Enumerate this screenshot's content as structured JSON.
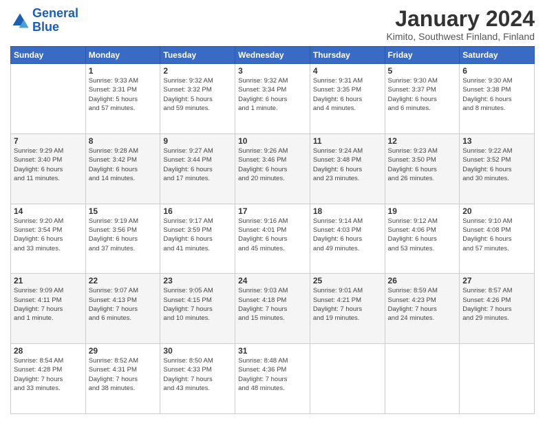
{
  "header": {
    "logo_line1": "General",
    "logo_line2": "Blue",
    "month": "January 2024",
    "location": "Kimito, Southwest Finland, Finland"
  },
  "weekdays": [
    "Sunday",
    "Monday",
    "Tuesday",
    "Wednesday",
    "Thursday",
    "Friday",
    "Saturday"
  ],
  "weeks": [
    [
      {
        "day": "",
        "info": ""
      },
      {
        "day": "1",
        "info": "Sunrise: 9:33 AM\nSunset: 3:31 PM\nDaylight: 5 hours\nand 57 minutes."
      },
      {
        "day": "2",
        "info": "Sunrise: 9:32 AM\nSunset: 3:32 PM\nDaylight: 5 hours\nand 59 minutes."
      },
      {
        "day": "3",
        "info": "Sunrise: 9:32 AM\nSunset: 3:34 PM\nDaylight: 6 hours\nand 1 minute."
      },
      {
        "day": "4",
        "info": "Sunrise: 9:31 AM\nSunset: 3:35 PM\nDaylight: 6 hours\nand 4 minutes."
      },
      {
        "day": "5",
        "info": "Sunrise: 9:30 AM\nSunset: 3:37 PM\nDaylight: 6 hours\nand 6 minutes."
      },
      {
        "day": "6",
        "info": "Sunrise: 9:30 AM\nSunset: 3:38 PM\nDaylight: 6 hours\nand 8 minutes."
      }
    ],
    [
      {
        "day": "7",
        "info": "Sunrise: 9:29 AM\nSunset: 3:40 PM\nDaylight: 6 hours\nand 11 minutes."
      },
      {
        "day": "8",
        "info": "Sunrise: 9:28 AM\nSunset: 3:42 PM\nDaylight: 6 hours\nand 14 minutes."
      },
      {
        "day": "9",
        "info": "Sunrise: 9:27 AM\nSunset: 3:44 PM\nDaylight: 6 hours\nand 17 minutes."
      },
      {
        "day": "10",
        "info": "Sunrise: 9:26 AM\nSunset: 3:46 PM\nDaylight: 6 hours\nand 20 minutes."
      },
      {
        "day": "11",
        "info": "Sunrise: 9:24 AM\nSunset: 3:48 PM\nDaylight: 6 hours\nand 23 minutes."
      },
      {
        "day": "12",
        "info": "Sunrise: 9:23 AM\nSunset: 3:50 PM\nDaylight: 6 hours\nand 26 minutes."
      },
      {
        "day": "13",
        "info": "Sunrise: 9:22 AM\nSunset: 3:52 PM\nDaylight: 6 hours\nand 30 minutes."
      }
    ],
    [
      {
        "day": "14",
        "info": "Sunrise: 9:20 AM\nSunset: 3:54 PM\nDaylight: 6 hours\nand 33 minutes."
      },
      {
        "day": "15",
        "info": "Sunrise: 9:19 AM\nSunset: 3:56 PM\nDaylight: 6 hours\nand 37 minutes."
      },
      {
        "day": "16",
        "info": "Sunrise: 9:17 AM\nSunset: 3:59 PM\nDaylight: 6 hours\nand 41 minutes."
      },
      {
        "day": "17",
        "info": "Sunrise: 9:16 AM\nSunset: 4:01 PM\nDaylight: 6 hours\nand 45 minutes."
      },
      {
        "day": "18",
        "info": "Sunrise: 9:14 AM\nSunset: 4:03 PM\nDaylight: 6 hours\nand 49 minutes."
      },
      {
        "day": "19",
        "info": "Sunrise: 9:12 AM\nSunset: 4:06 PM\nDaylight: 6 hours\nand 53 minutes."
      },
      {
        "day": "20",
        "info": "Sunrise: 9:10 AM\nSunset: 4:08 PM\nDaylight: 6 hours\nand 57 minutes."
      }
    ],
    [
      {
        "day": "21",
        "info": "Sunrise: 9:09 AM\nSunset: 4:11 PM\nDaylight: 7 hours\nand 1 minute."
      },
      {
        "day": "22",
        "info": "Sunrise: 9:07 AM\nSunset: 4:13 PM\nDaylight: 7 hours\nand 6 minutes."
      },
      {
        "day": "23",
        "info": "Sunrise: 9:05 AM\nSunset: 4:15 PM\nDaylight: 7 hours\nand 10 minutes."
      },
      {
        "day": "24",
        "info": "Sunrise: 9:03 AM\nSunset: 4:18 PM\nDaylight: 7 hours\nand 15 minutes."
      },
      {
        "day": "25",
        "info": "Sunrise: 9:01 AM\nSunset: 4:21 PM\nDaylight: 7 hours\nand 19 minutes."
      },
      {
        "day": "26",
        "info": "Sunrise: 8:59 AM\nSunset: 4:23 PM\nDaylight: 7 hours\nand 24 minutes."
      },
      {
        "day": "27",
        "info": "Sunrise: 8:57 AM\nSunset: 4:26 PM\nDaylight: 7 hours\nand 29 minutes."
      }
    ],
    [
      {
        "day": "28",
        "info": "Sunrise: 8:54 AM\nSunset: 4:28 PM\nDaylight: 7 hours\nand 33 minutes."
      },
      {
        "day": "29",
        "info": "Sunrise: 8:52 AM\nSunset: 4:31 PM\nDaylight: 7 hours\nand 38 minutes."
      },
      {
        "day": "30",
        "info": "Sunrise: 8:50 AM\nSunset: 4:33 PM\nDaylight: 7 hours\nand 43 minutes."
      },
      {
        "day": "31",
        "info": "Sunrise: 8:48 AM\nSunset: 4:36 PM\nDaylight: 7 hours\nand 48 minutes."
      },
      {
        "day": "",
        "info": ""
      },
      {
        "day": "",
        "info": ""
      },
      {
        "day": "",
        "info": ""
      }
    ]
  ]
}
